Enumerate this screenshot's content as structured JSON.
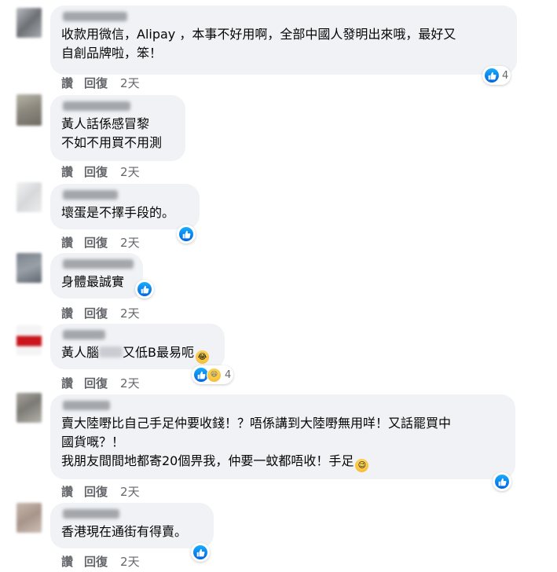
{
  "actions": {
    "like": "讚",
    "reply": "回復",
    "time": "2天"
  },
  "comments": [
    {
      "text": "收款用微信，Alipay ，本事不好用啊，全部中國人發明出來哦，最好又\n自創品牌啦，笨！",
      "reaction_count": "4"
    },
    {
      "text": "黃人話係感冒黎\n不如不用買不用測",
      "reaction_count": ""
    },
    {
      "text": "壞蛋是不擇手段的。",
      "reaction_count": ""
    },
    {
      "text": "身體最誠實",
      "reaction_count": ""
    },
    {
      "text_a": "黃人腦",
      "text_b": "又低B最易呃",
      "reaction_count": "4"
    },
    {
      "text": "賣大陸嘢比自己手足仲要收錢！？唔係講到大陸嘢無用咩！又話罷買中\n國貨嘅？！\n我朋友間間地都寄20個畀我，仲要一蚊都唔收！手足",
      "reaction_count": ""
    },
    {
      "text": "香港現在通街有得賣。",
      "reaction_count": ""
    }
  ],
  "icons": {
    "like": "like-icon",
    "haha": "haha-emoji-icon",
    "wink": "wink-emoji-icon"
  },
  "colors": {
    "bubble": "#f0f2f5",
    "like_blue": "#0866ff",
    "meta_gray": "#65676b"
  }
}
